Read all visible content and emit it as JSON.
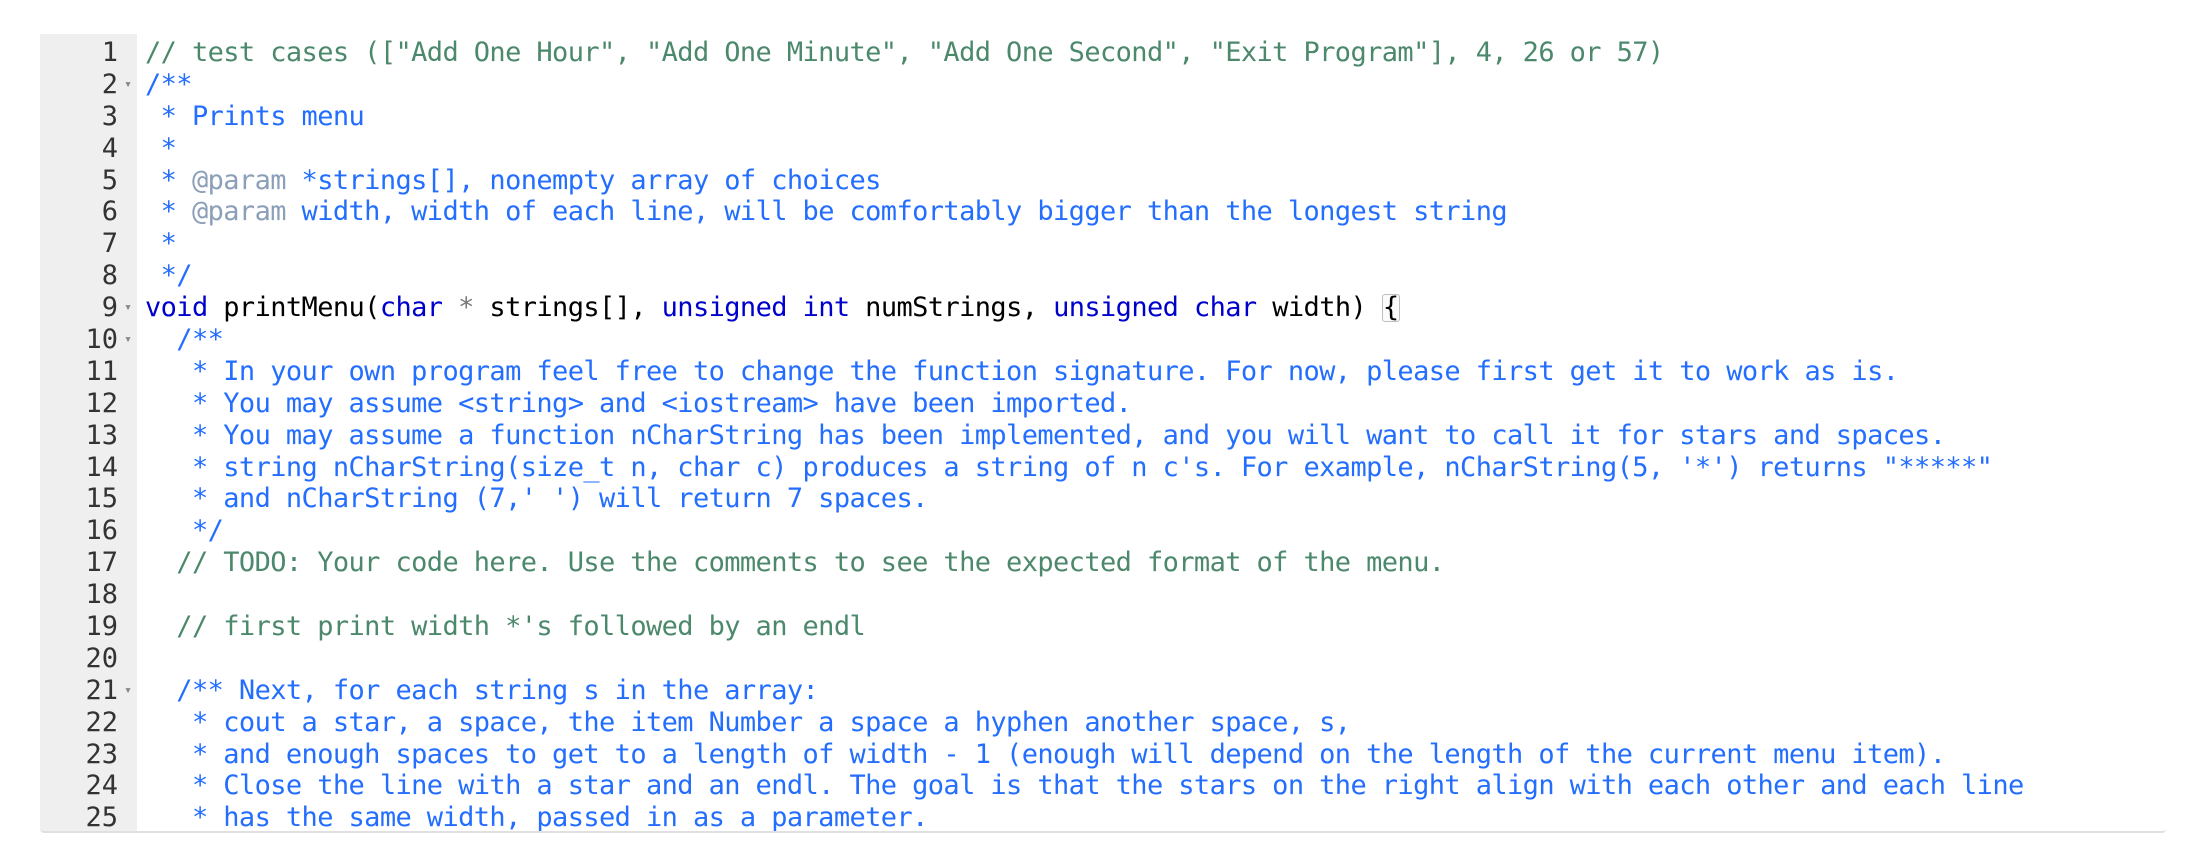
{
  "editor": {
    "lines": [
      {
        "n": "1",
        "fold": false,
        "segments": [
          {
            "t": "// test cases ([\"Add One Hour\", \"Add One Minute\", \"Add One Second\", \"Exit Program\"], 4, 26 or 57)",
            "c": "c-line"
          }
        ]
      },
      {
        "n": "2",
        "fold": true,
        "segments": [
          {
            "t": "/**",
            "c": "c-doc"
          }
        ]
      },
      {
        "n": "3",
        "fold": false,
        "segments": [
          {
            "t": " * Prints menu",
            "c": "c-doc"
          }
        ]
      },
      {
        "n": "4",
        "fold": false,
        "segments": [
          {
            "t": " *",
            "c": "c-doc"
          }
        ]
      },
      {
        "n": "5",
        "fold": false,
        "segments": [
          {
            "t": " * ",
            "c": "c-doc"
          },
          {
            "t": "@param",
            "c": "c-tag"
          },
          {
            "t": " *strings[], nonempty array of choices",
            "c": "c-doc"
          }
        ]
      },
      {
        "n": "6",
        "fold": false,
        "segments": [
          {
            "t": " * ",
            "c": "c-doc"
          },
          {
            "t": "@param",
            "c": "c-tag"
          },
          {
            "t": " width, width of each line, will be comfortably bigger than the longest string",
            "c": "c-doc"
          }
        ]
      },
      {
        "n": "7",
        "fold": false,
        "segments": [
          {
            "t": " *",
            "c": "c-doc"
          }
        ]
      },
      {
        "n": "8",
        "fold": false,
        "segments": [
          {
            "t": " */",
            "c": "c-doc"
          }
        ]
      },
      {
        "n": "9",
        "fold": true,
        "segments": [
          {
            "t": "void",
            "c": "kw"
          },
          {
            "t": " printMenu(",
            "c": "id"
          },
          {
            "t": "char",
            "c": "kw"
          },
          {
            "t": " ",
            "c": "id"
          },
          {
            "t": "*",
            "c": "op"
          },
          {
            "t": " strings[], ",
            "c": "id"
          },
          {
            "t": "unsigned",
            "c": "kw"
          },
          {
            "t": " ",
            "c": "id"
          },
          {
            "t": "int",
            "c": "kw"
          },
          {
            "t": " numStrings, ",
            "c": "id"
          },
          {
            "t": "unsigned",
            "c": "kw"
          },
          {
            "t": " ",
            "c": "id"
          },
          {
            "t": "char",
            "c": "kw"
          },
          {
            "t": " width) ",
            "c": "id"
          },
          {
            "t": "{",
            "c": "brace"
          }
        ]
      },
      {
        "n": "10",
        "fold": true,
        "segments": [
          {
            "t": "  /**",
            "c": "c-doc"
          }
        ]
      },
      {
        "n": "11",
        "fold": false,
        "segments": [
          {
            "t": "   * In your own program feel free to change the function signature. For now, please first get it to work as is.",
            "c": "c-doc"
          }
        ]
      },
      {
        "n": "12",
        "fold": false,
        "segments": [
          {
            "t": "   * You may assume <string> and <iostream> have been imported.",
            "c": "c-doc"
          }
        ]
      },
      {
        "n": "13",
        "fold": false,
        "segments": [
          {
            "t": "   * You may assume a function nCharString has been implemented, and you will want to call it for stars and spaces.",
            "c": "c-doc"
          }
        ]
      },
      {
        "n": "14",
        "fold": false,
        "segments": [
          {
            "t": "   * string nCharString(size_t n, char c) produces a string of n c's. For example, nCharString(5, '*') returns \"*****\"",
            "c": "c-doc"
          }
        ]
      },
      {
        "n": "15",
        "fold": false,
        "segments": [
          {
            "t": "   * and nCharString (7,' ') will return 7 spaces.",
            "c": "c-doc"
          }
        ]
      },
      {
        "n": "16",
        "fold": false,
        "segments": [
          {
            "t": "   */",
            "c": "c-doc"
          }
        ]
      },
      {
        "n": "17",
        "fold": false,
        "segments": [
          {
            "t": "  // TODO: Your code here. Use the comments to see the expected format of the menu.",
            "c": "c-line"
          }
        ]
      },
      {
        "n": "18",
        "fold": false,
        "segments": []
      },
      {
        "n": "19",
        "fold": false,
        "segments": [
          {
            "t": "  // first print width *'s followed by an endl",
            "c": "c-line"
          }
        ]
      },
      {
        "n": "20",
        "fold": false,
        "segments": []
      },
      {
        "n": "21",
        "fold": true,
        "segments": [
          {
            "t": "  /** Next, for each string s in the array:",
            "c": "c-doc"
          }
        ]
      },
      {
        "n": "22",
        "fold": false,
        "segments": [
          {
            "t": "   * cout a star, a space, the item Number a space a hyphen another space, s,",
            "c": "c-doc"
          }
        ]
      },
      {
        "n": "23",
        "fold": false,
        "segments": [
          {
            "t": "   * and enough spaces to get to a length of width - 1 (enough will depend on the length of the current menu item).",
            "c": "c-doc"
          }
        ]
      },
      {
        "n": "24",
        "fold": false,
        "segments": [
          {
            "t": "   * Close the line with a star and an endl. The goal is that the stars on the right align with each other and each line",
            "c": "c-doc"
          }
        ]
      },
      {
        "n": "25",
        "fold": false,
        "segments": [
          {
            "t": "   * has the same width, passed in as a parameter.",
            "c": "c-doc"
          }
        ]
      }
    ],
    "fold_icon": "triangle-down-icon",
    "colors": {
      "line_comment": "#4c886b",
      "doc_comment": "#236eff",
      "doc_tag": "#8b9fb8",
      "keyword": "#0000cc",
      "gutter_bg": "#efefef"
    }
  }
}
